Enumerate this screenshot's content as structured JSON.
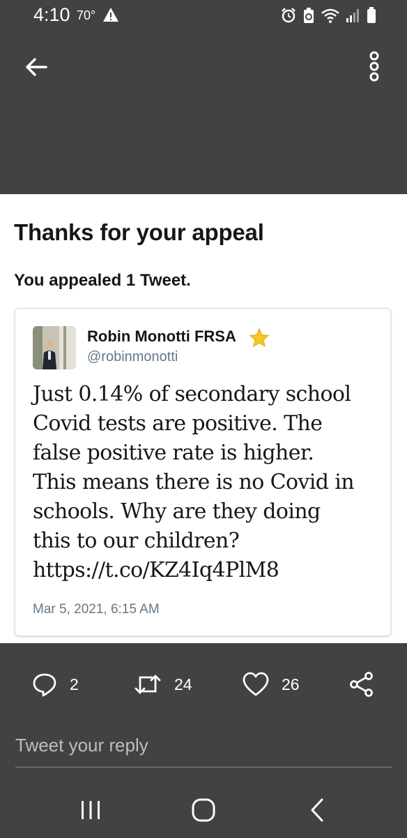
{
  "status_bar": {
    "time": "4:10",
    "temperature": "70°",
    "icons": [
      "warning-icon",
      "alarm-icon",
      "battery-saver-icon",
      "wifi-icon",
      "signal-icon",
      "battery-icon"
    ]
  },
  "app_bar": {
    "back_icon": "arrow-left-icon",
    "menu_icon": "more-vertical-icon"
  },
  "appeal": {
    "title": "Thanks for your appeal",
    "subtitle": "You appealed 1 Tweet."
  },
  "tweet": {
    "author_name": "Robin Monotti FRSA",
    "author_badge": "star-emoji",
    "handle": "@robinmonotti",
    "text": "Just 0.14% of secondary school\nCovid tests are positive. The\nfalse positive rate is higher.\nThis means there is no Covid in\nschools. Why are they doing\nthis to our children?\nhttps://t.co/KZ4Iq4PlM8",
    "date": "Mar 5, 2021, 6:15 AM"
  },
  "actions": {
    "replies": "2",
    "retweets": "24",
    "likes": "26"
  },
  "reply": {
    "placeholder": "Tweet your reply"
  },
  "colors": {
    "dark_bg": "#424242",
    "card_bg": "#ffffff",
    "text_primary": "#14171a",
    "text_secondary": "#657786"
  }
}
